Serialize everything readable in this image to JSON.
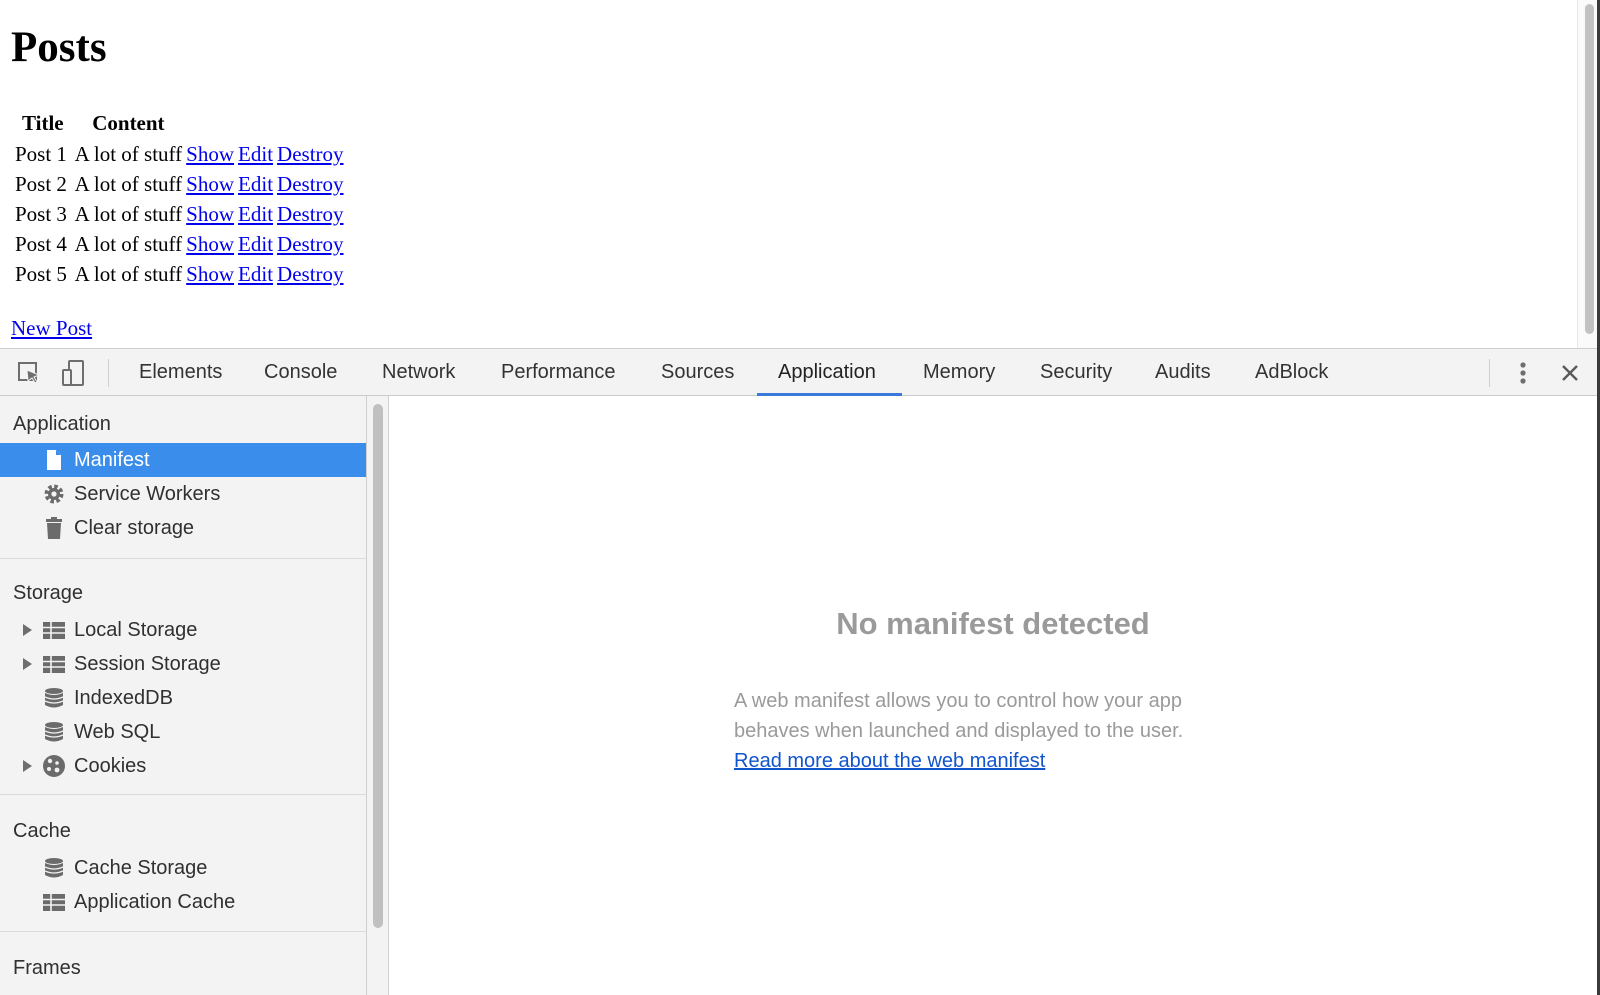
{
  "page": {
    "title": "Posts",
    "table_headers": [
      "Title",
      "Content"
    ],
    "rows": [
      {
        "title": "Post 1",
        "content": "A lot of stuff",
        "show": "Show",
        "edit": "Edit",
        "destroy": "Destroy"
      },
      {
        "title": "Post 2",
        "content": "A lot of stuff",
        "show": "Show",
        "edit": "Edit",
        "destroy": "Destroy"
      },
      {
        "title": "Post 3",
        "content": "A lot of stuff",
        "show": "Show",
        "edit": "Edit",
        "destroy": "Destroy"
      },
      {
        "title": "Post 4",
        "content": "A lot of stuff",
        "show": "Show",
        "edit": "Edit",
        "destroy": "Destroy"
      },
      {
        "title": "Post 5",
        "content": "A lot of stuff",
        "show": "Show",
        "edit": "Edit",
        "destroy": "Destroy"
      }
    ],
    "new_post_link": "New Post"
  },
  "devtools": {
    "tabs": [
      "Elements",
      "Console",
      "Network",
      "Performance",
      "Sources",
      "Application",
      "Memory",
      "Security",
      "Audits",
      "AdBlock"
    ],
    "active_tab": "Application",
    "toolbar_icons": [
      "inspect-element-icon",
      "device-toolbar-icon",
      "more-options-icon",
      "close-icon"
    ],
    "sidebar": {
      "sections": [
        {
          "header": "Application",
          "items": [
            {
              "label": "Manifest",
              "icon": "document-icon",
              "selected": true
            },
            {
              "label": "Service Workers",
              "icon": "gear-icon"
            },
            {
              "label": "Clear storage",
              "icon": "trash-icon"
            }
          ]
        },
        {
          "header": "Storage",
          "items": [
            {
              "label": "Local Storage",
              "icon": "table-icon",
              "expandable": true
            },
            {
              "label": "Session Storage",
              "icon": "table-icon",
              "expandable": true
            },
            {
              "label": "IndexedDB",
              "icon": "database-icon"
            },
            {
              "label": "Web SQL",
              "icon": "database-icon"
            },
            {
              "label": "Cookies",
              "icon": "cookie-icon",
              "expandable": true
            }
          ]
        },
        {
          "header": "Cache",
          "items": [
            {
              "label": "Cache Storage",
              "icon": "database-icon"
            },
            {
              "label": "Application Cache",
              "icon": "table-icon"
            }
          ]
        },
        {
          "header": "Frames",
          "items": []
        }
      ]
    },
    "main": {
      "empty_title": "No manifest detected",
      "empty_description": "A web manifest allows you to control how your app behaves when launched and displayed to the user.",
      "link_text": "Read more about the web manifest"
    },
    "colors": {
      "selected_bg": "#3a8dea",
      "tab_underline": "#3879d9",
      "link": "#1155cc",
      "muted_text": "#9a9a9a"
    }
  }
}
